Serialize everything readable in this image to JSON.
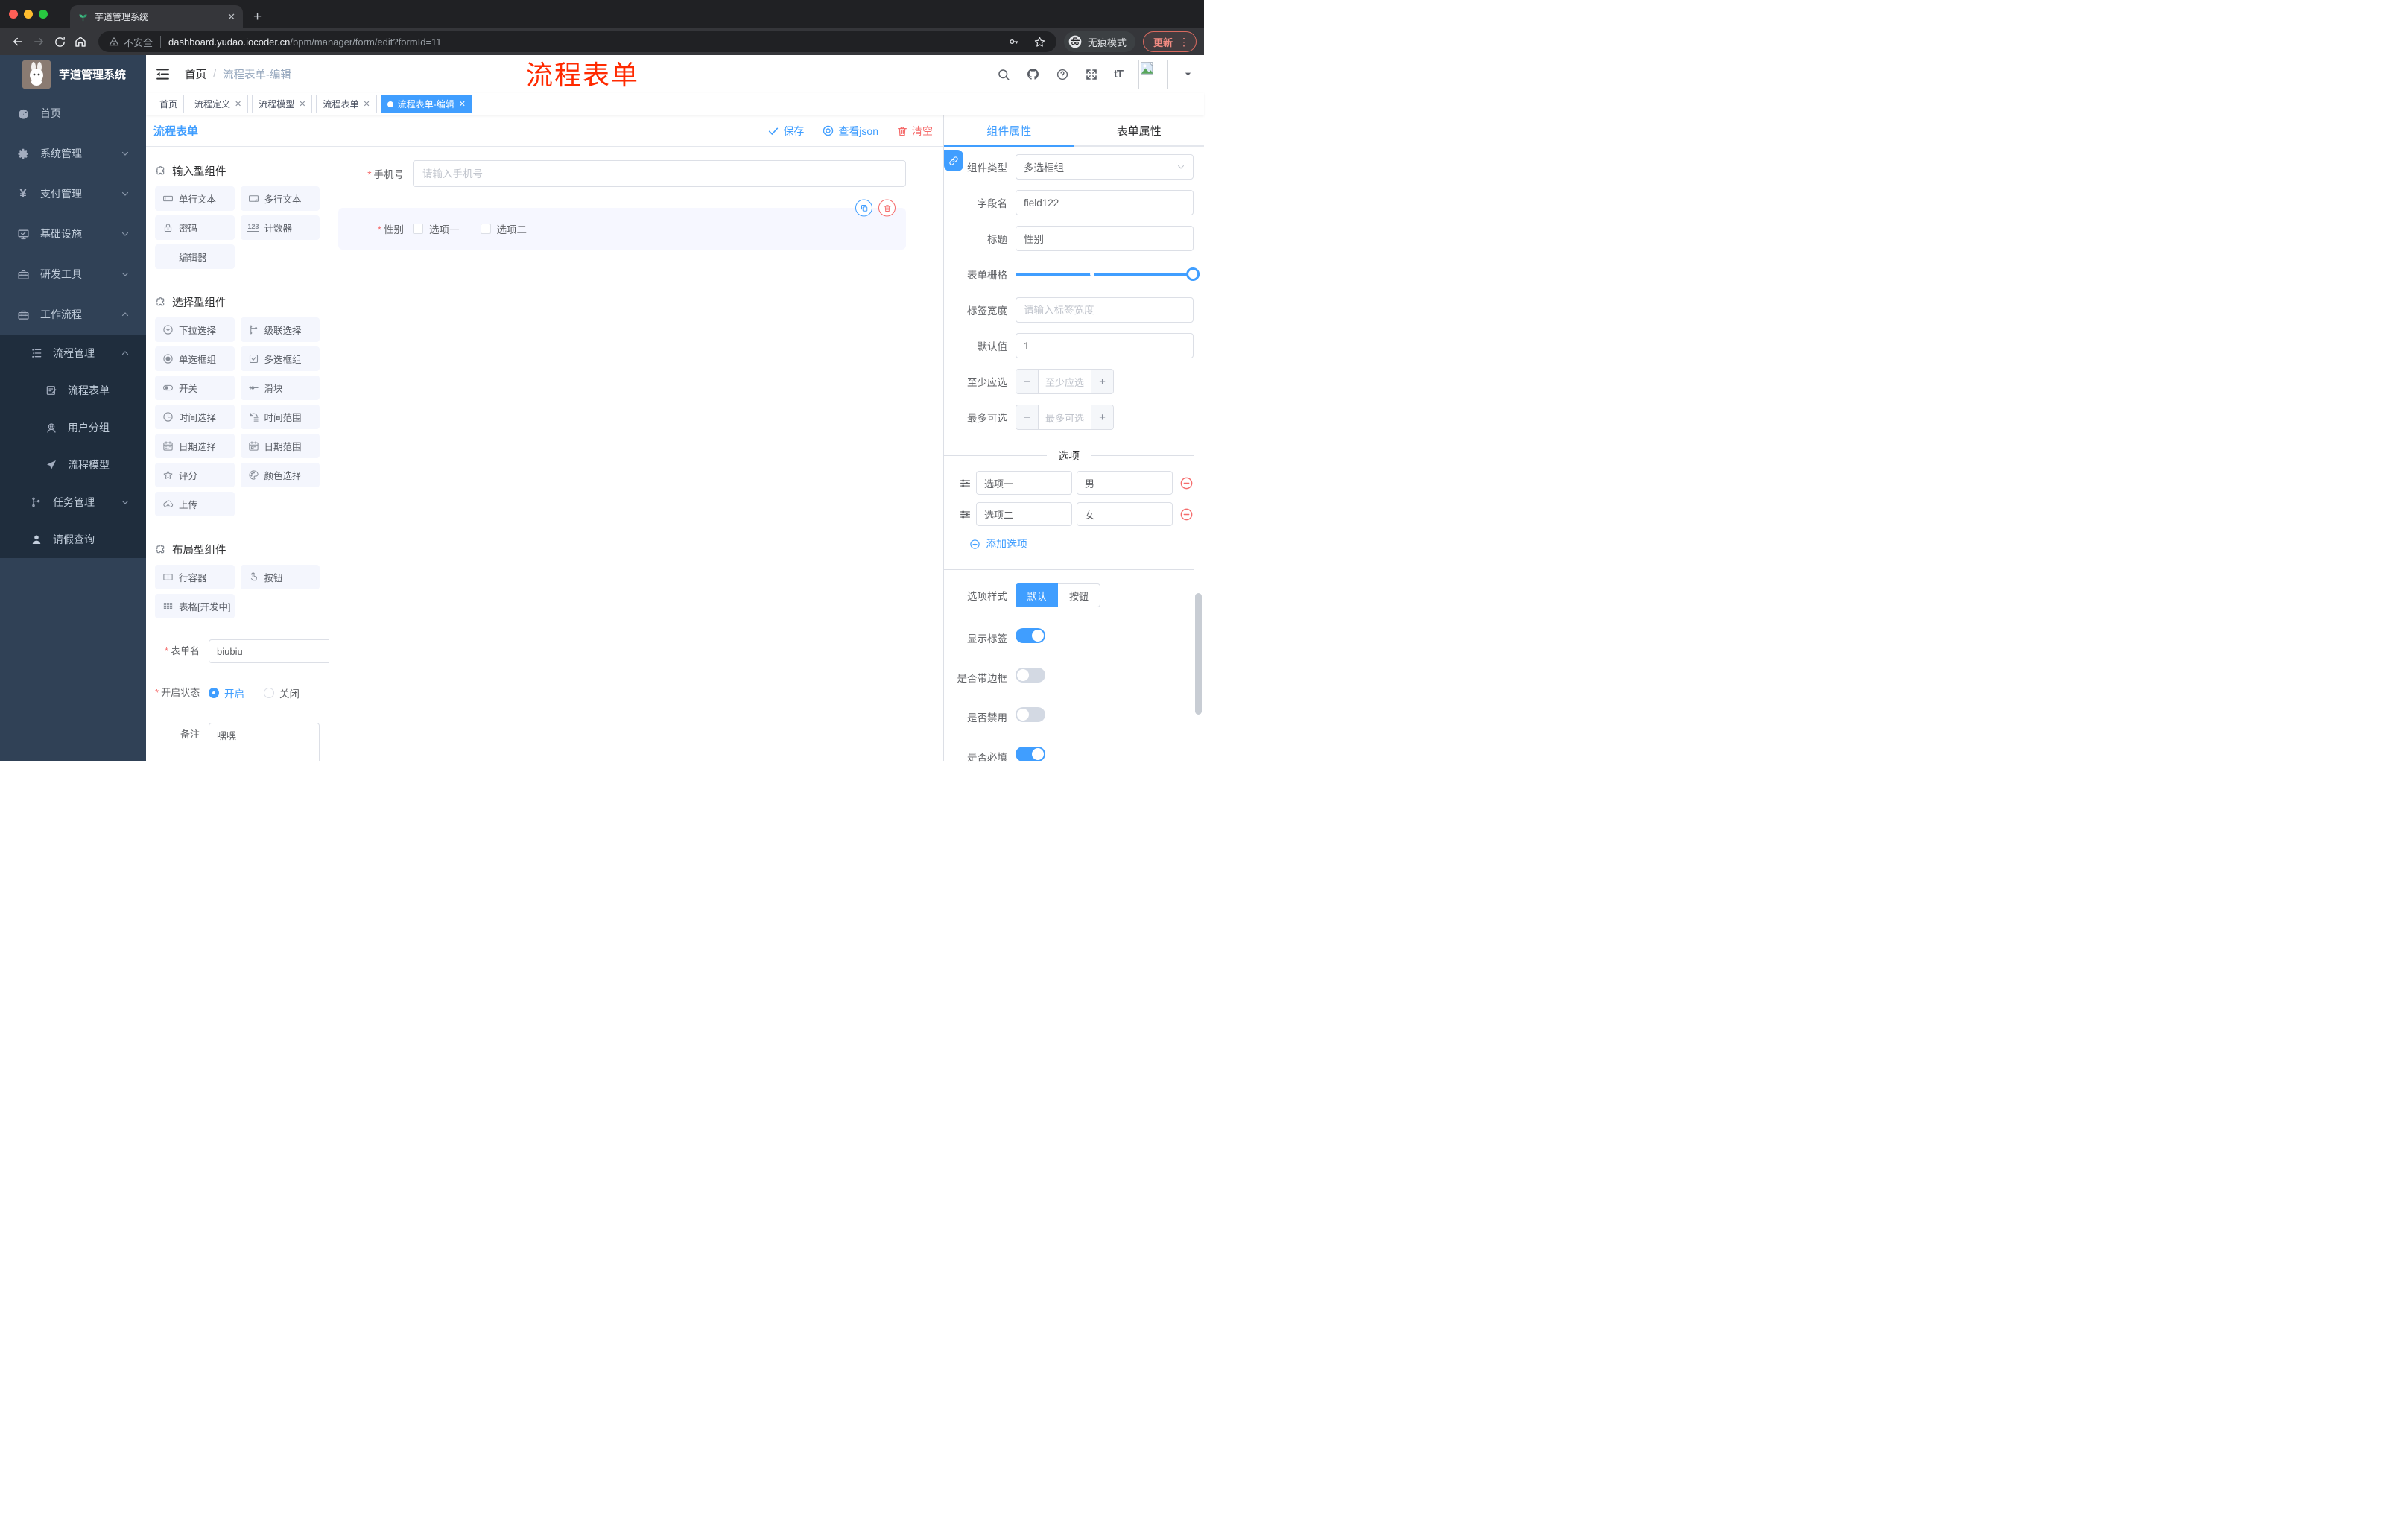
{
  "browser": {
    "tab_title": "芋道管理系统",
    "security_label": "不安全",
    "url_host": "dashboard.yudao.iocoder.cn",
    "url_path": "/bpm/manager/form/edit?formId=11",
    "incognito_label": "无痕模式",
    "update_label": "更新"
  },
  "sidebar": {
    "app_title": "芋道管理系统",
    "items": [
      {
        "label": "首页"
      },
      {
        "label": "系统管理"
      },
      {
        "label": "支付管理"
      },
      {
        "label": "基础设施"
      },
      {
        "label": "研发工具"
      },
      {
        "label": "工作流程"
      },
      {
        "label": "流程管理"
      },
      {
        "label": "流程表单"
      },
      {
        "label": "用户分组"
      },
      {
        "label": "流程模型"
      },
      {
        "label": "任务管理"
      },
      {
        "label": "请假查询"
      }
    ]
  },
  "header": {
    "breadcrumb_home": "首页",
    "breadcrumb_sep": "/",
    "breadcrumb_current": "流程表单-编辑"
  },
  "annotation_text": "流程表单",
  "tags": [
    {
      "label": "首页"
    },
    {
      "label": "流程定义"
    },
    {
      "label": "流程模型"
    },
    {
      "label": "流程表单"
    },
    {
      "label": "流程表单-编辑"
    }
  ],
  "designer": {
    "title": "流程表单",
    "save_label": "保存",
    "view_json_label": "查看json",
    "clear_label": "清空"
  },
  "palette": {
    "section_input": "输入型组件",
    "section_select": "选择型组件",
    "section_layout": "布局型组件",
    "counter_glyph": "123",
    "input_items": [
      "单行文本",
      "多行文本",
      "密码",
      "计数器",
      "编辑器"
    ],
    "select_items": [
      "下拉选择",
      "级联选择",
      "单选框组",
      "多选框组",
      "开关",
      "滑块",
      "时间选择",
      "时间范围",
      "日期选择",
      "日期范围",
      "评分",
      "颜色选择",
      "上传"
    ],
    "layout_items": [
      "行容器",
      "按钮",
      "表格[开发中]"
    ]
  },
  "form_meta": {
    "name_label": "表单名",
    "name_value": "biubiu",
    "status_label": "开启状态",
    "status_on": "开启",
    "status_off": "关闭",
    "remark_label": "备注",
    "remark_value": "嘿嘿"
  },
  "canvas": {
    "phone_label": "手机号",
    "phone_placeholder": "请输入手机号",
    "gender_label": "性别",
    "gender_options": [
      "选项一",
      "选项二"
    ]
  },
  "props": {
    "tab_component": "组件属性",
    "tab_form": "表单属性",
    "type_label": "组件类型",
    "type_value": "多选框组",
    "field_label": "字段名",
    "field_value": "field122",
    "title_label": "标题",
    "title_value": "性别",
    "grid_label": "表单栅格",
    "label_width_label": "标签宽度",
    "label_width_placeholder": "请输入标签宽度",
    "default_label": "默认值",
    "default_value": "1",
    "min_label": "至少应选",
    "min_placeholder": "至少应选",
    "max_label": "最多可选",
    "max_placeholder": "最多可选",
    "options_title": "选项",
    "options": [
      {
        "text": "选项一",
        "value": "男"
      },
      {
        "text": "选项二",
        "value": "女"
      }
    ],
    "add_option_label": "添加选项",
    "style_label": "选项样式",
    "style_default": "默认",
    "style_button": "按钮",
    "toggle_show_label": "显示标签",
    "toggle_border": "是否带边框",
    "toggle_disabled": "是否禁用",
    "toggle_required": "是否必填"
  }
}
